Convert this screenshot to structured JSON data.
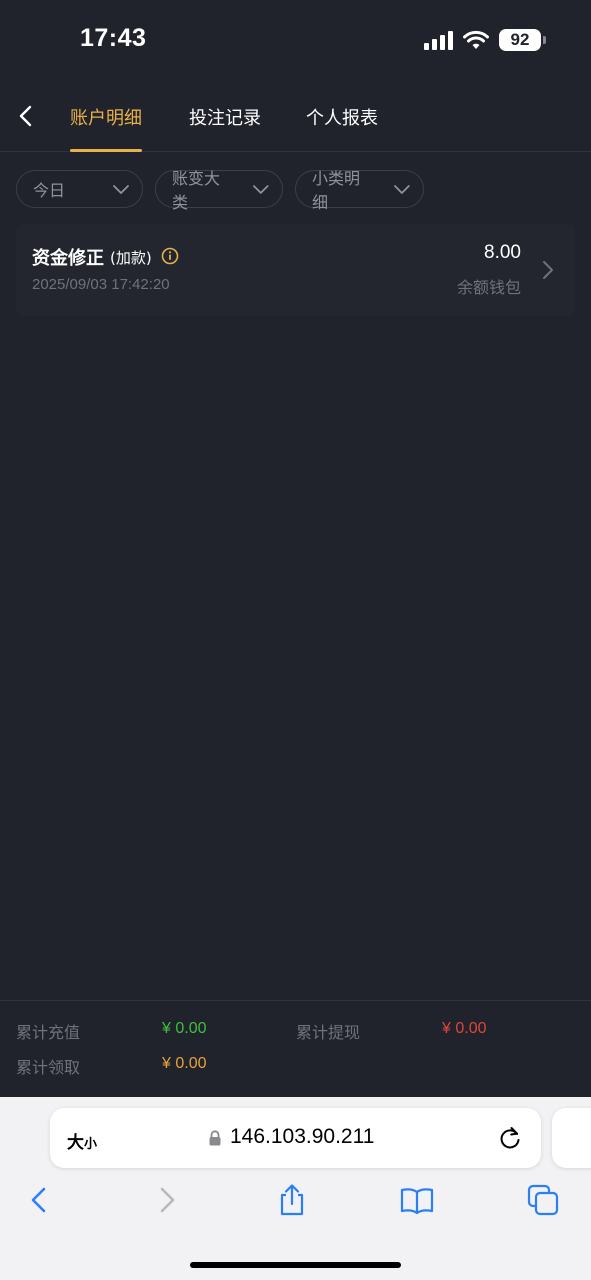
{
  "status_bar": {
    "time": "17:43",
    "battery": "92"
  },
  "nav": {
    "tabs": [
      {
        "label": "账户明细",
        "active": true
      },
      {
        "label": "投注记录",
        "active": false
      },
      {
        "label": "个人报表",
        "active": false
      }
    ]
  },
  "filters": [
    "今日",
    "账变大类",
    "小类明细"
  ],
  "record": {
    "title": "资金修正",
    "subtitle": "(加款)",
    "time": "2025/09/03 17:42:20",
    "amount": "8.00",
    "wallet": "余额钱包"
  },
  "summary": {
    "recharge_label": "累计充值",
    "recharge_value": "¥ 0.00",
    "withdraw_label": "累计提现",
    "withdraw_value": "¥ 0.00",
    "claim_label": "累计领取",
    "claim_value": "¥ 0.00"
  },
  "browser": {
    "aa_big": "大",
    "aa_small": "小",
    "url": "146.103.90.211"
  },
  "colors": {
    "accent": "#e8b04a",
    "recharge": "#3fbf3f",
    "withdraw": "#e0453a",
    "claim": "#e8a23a",
    "ios_blue": "#2a7ff6"
  }
}
